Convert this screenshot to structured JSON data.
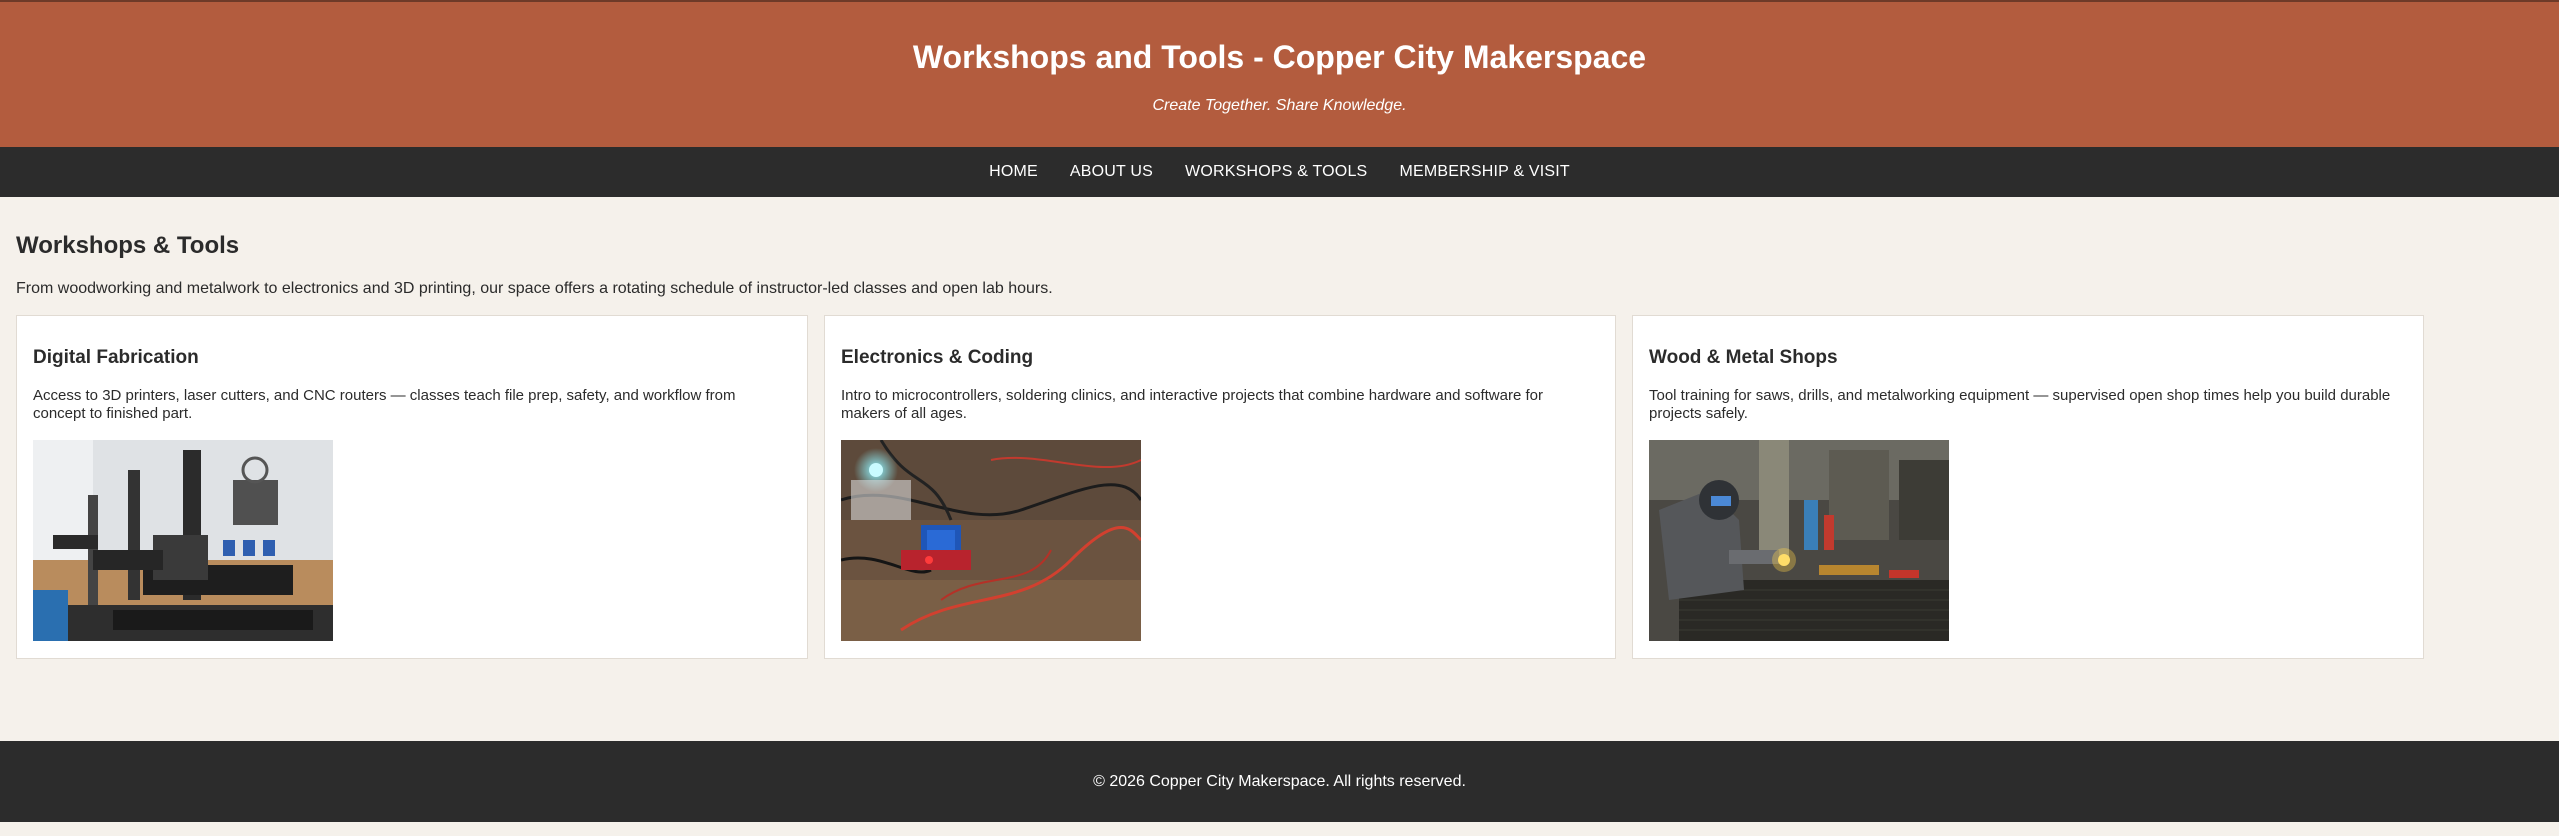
{
  "header": {
    "title": "Workshops and Tools - Copper City Makerspace",
    "tagline": "Create Together. Share Knowledge."
  },
  "nav": {
    "items": [
      {
        "label": "HOME"
      },
      {
        "label": "ABOUT US"
      },
      {
        "label": "WORKSHOPS & TOOLS"
      },
      {
        "label": "MEMBERSHIP & VISIT"
      }
    ]
  },
  "main": {
    "title": "Workshops & Tools",
    "intro": "From woodworking and metalwork to electronics and 3D printing, our space offers a rotating schedule of instructor-led classes and open lab hours.",
    "cards": [
      {
        "title": "Digital Fabrication",
        "description": "Access to 3D printers, laser cutters, and CNC routers — classes teach file prep, safety, and workflow from concept to finished part.",
        "image_icon": "3d-printer-photo"
      },
      {
        "title": "Electronics & Coding",
        "description": "Intro to microcontrollers, soldering clinics, and interactive projects that combine hardware and software for makers of all ages.",
        "image_icon": "electronics-relay-photo"
      },
      {
        "title": "Wood & Metal Shops",
        "description": "Tool training for saws, drills, and metalworking equipment — supervised open shop times help you build durable projects safely.",
        "image_icon": "welder-photo"
      }
    ]
  },
  "footer": {
    "copyright": "© 2026 Copper City Makerspace. All rights reserved."
  },
  "colors": {
    "header_bg": "#b35c3e",
    "nav_bg": "#2c2c2c",
    "page_bg": "#f5f1eb",
    "card_bg": "#ffffff",
    "footer_bg": "#2c2c2c"
  }
}
